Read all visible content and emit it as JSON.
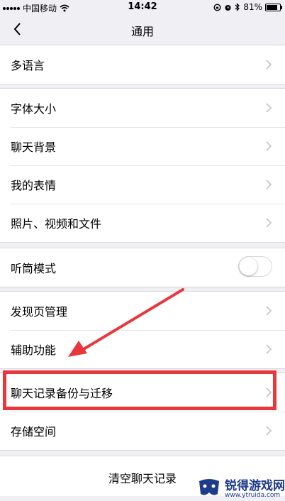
{
  "status_bar": {
    "carrier": "中国移动",
    "time": "14:42",
    "battery_percent": "81%",
    "battery_level": 0.81
  },
  "nav": {
    "title": "通用",
    "back_icon": "chevron-left-icon"
  },
  "groups": [
    {
      "items": [
        {
          "label": "多语言"
        }
      ]
    },
    {
      "items": [
        {
          "label": "字体大小"
        },
        {
          "label": "聊天背景"
        },
        {
          "label": "我的表情"
        },
        {
          "label": "照片、视频和文件"
        }
      ]
    },
    {
      "items": [
        {
          "label": "听筒模式",
          "toggle": false
        }
      ]
    },
    {
      "items": [
        {
          "label": "发现页管理"
        },
        {
          "label": "辅助功能"
        }
      ]
    },
    {
      "items": [
        {
          "label": "聊天记录备份与迁移",
          "highlighted": true
        },
        {
          "label": "存储空间"
        }
      ]
    }
  ],
  "clear_history": {
    "label": "清空聊天记录"
  },
  "watermark": {
    "title": "锐得游戏网",
    "url": "www.ytruida.com"
  },
  "colors": {
    "highlight": "#e8373c",
    "background": "#efeff4",
    "watermark": "#1e3a8a"
  }
}
